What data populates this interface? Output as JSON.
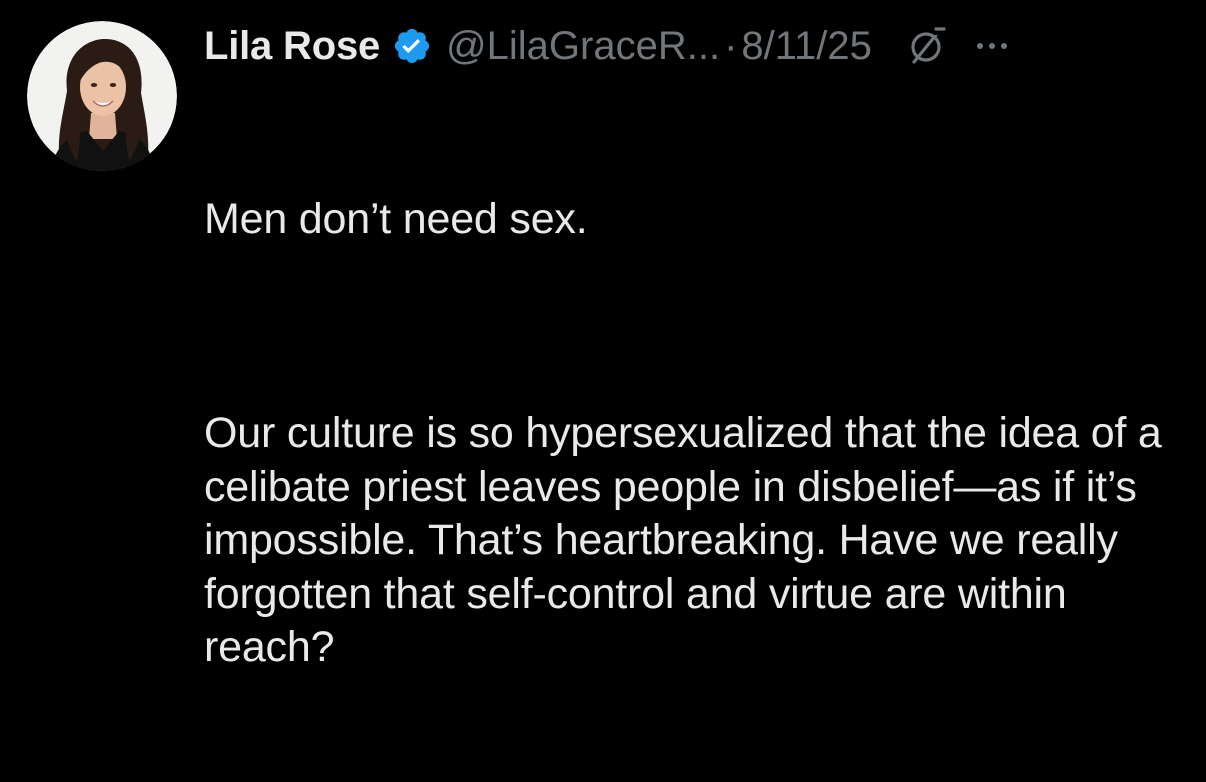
{
  "tweet": {
    "author": {
      "display_name": "Lila Rose",
      "handle": "@LilaGraceR...",
      "verified": true,
      "avatar_icon": "profile-photo"
    },
    "separator": "·",
    "date": "8/11/25",
    "icons": {
      "verified": "verified-badge-icon",
      "grok": "grok-icon",
      "more": "more-options-icon"
    },
    "text": {
      "line1": "Men don’t need sex.",
      "paragraph2": "Our culture is so hypersexualized that the idea of a celibate priest leaves people in disbelief—as if it’s impossible. That’s heartbreaking. Have we really forgotten that self-control and virtue are within reach?"
    },
    "colors": {
      "background": "#000000",
      "primary_text": "#e7e9ea",
      "secondary_text": "#71767b",
      "verified_blue": "#1d9bf0"
    }
  }
}
